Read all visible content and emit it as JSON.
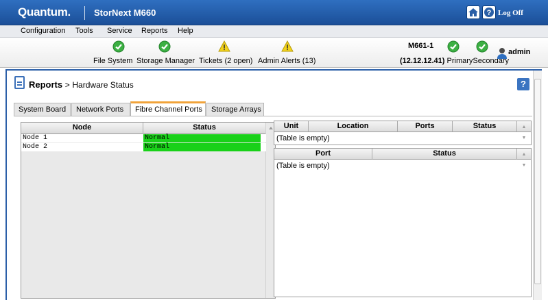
{
  "header": {
    "brand": "Quantum.",
    "product": "StorNext M660",
    "logoff_label": "Log Off"
  },
  "menu": {
    "items": [
      "Configuration",
      "Tools",
      "Service",
      "Reports",
      "Help"
    ]
  },
  "status": {
    "file_system": "File System",
    "storage_manager": "Storage Manager",
    "tickets": "Tickets (2 open)",
    "admin_alerts": "Admin Alerts (13)",
    "node_name": "M661-1",
    "node_ip": "(12.12.12.41)",
    "primary": "Primary",
    "secondary": "Secondary",
    "user": "admin",
    "colors": {
      "ok": "#3cb043",
      "warning": "#f2d21b"
    }
  },
  "page": {
    "breadcrumb_section": "Reports",
    "breadcrumb_sep": ">",
    "breadcrumb_page": "Hardware Status",
    "help_label": "?"
  },
  "tabs": [
    {
      "label": "System Board",
      "active": false
    },
    {
      "label": "Network Ports",
      "active": false
    },
    {
      "label": "Fibre Channel Ports",
      "active": true
    },
    {
      "label": "Storage Arrays",
      "active": false
    }
  ],
  "node_table": {
    "columns": [
      "Node",
      "Status"
    ],
    "rows": [
      {
        "node": "Node 1",
        "status": "Normal"
      },
      {
        "node": "Node 2",
        "status": "Normal"
      }
    ],
    "status_color": "#19d119"
  },
  "unit_table": {
    "columns": [
      "Unit",
      "Location",
      "Ports",
      "Status"
    ],
    "empty_text": "(Table is empty)"
  },
  "port_table": {
    "columns": [
      "Port",
      "Status"
    ],
    "empty_text": "(Table is empty)"
  }
}
